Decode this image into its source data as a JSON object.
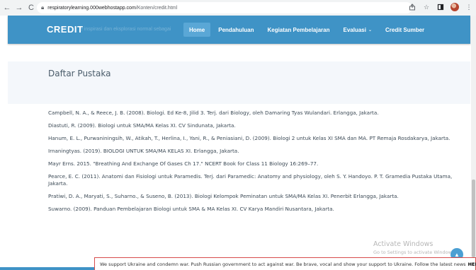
{
  "browser": {
    "url_host": "respiratorylearning.000webhostapp.com",
    "url_path": "/Konten/credit.html",
    "back_glyph": "←",
    "forward_glyph": "→",
    "reload_glyph": "C",
    "icons": [
      "share-icon",
      "star-icon",
      "tab-icon",
      "profile-avatar",
      "menu-icon"
    ]
  },
  "navbar": {
    "brand": "CREDIT",
    "brand_subtitle": "e inspirasi dan eksplorasi normal sebagai",
    "menu": [
      "Home",
      "Pendahuluan",
      "Kegiatan Pembelajaran",
      "Evaluasi",
      "Credit Sumber"
    ],
    "active_item": "Home",
    "dropdown_item": "Evaluasi",
    "color_bar": "#3f93c6"
  },
  "section": {
    "title": "Daftar Pustaka"
  },
  "references": [
    "Campbell, N. A., & Reece, J. B. (2008). Biologi. Ed Ke-8, Jilid 3. Terj. dari Biology, oleh Damaring Tyas Wulandari. Erlangga, Jakarta.",
    "Diastuti, R. (2009). Biologi untuk SMA/MA Kelas XI. CV Sindunata, Jakarta.",
    "Hanum, E. L., Purwaniningsih, W., Atikah, T., Herlina, I., Yani, R., & Peniasiani, D. (2009). Biologi 2 untuk Kelas XI SMA dan MA. PT Remaja Rosdakarya, Jakarta.",
    "Irnaningtyas. (2019). BIOLOGI UNTUK SMA/MA KELAS XI. Erlangga, Jakarta.",
    "Mayr Erns. 2015. \"Breathing And Exchange Of Gases Ch 17.\" NCERT Book for Class 11 Biology 16:269–77.",
    "Pearce, E. C. (2011). Anatomi dan Fisiologi untuk Paramedis. Terj. dari Paramedic: Anatomy and physiology, oleh S. Y. Handoyo. P. T. Gramedia Pustaka Utama, Jakarta.",
    "Pratiwi, D. A., Maryati, S., Suharno., & Suseno, B. (2013). Biologi Kelompok Peminatan untuk SMA/MA Kelas XI. Penerbit Erlangga, Jakarta.",
    "Suwarno. (2009). Panduan Pembelajaran Biologi untuk SMA & MA Kelas XI. CV Karya Mandiri Nusantara, Jakarta."
  ],
  "watermark": {
    "line1": "Activate Windows",
    "line2": "Go to Settings to activate Windows."
  },
  "banner": {
    "text": "We support Ukraine and condemn war. Push Russian government to act against war. Be brave, vocal and show your support to Ukraine. Follow the latest news",
    "link": "HERE"
  }
}
